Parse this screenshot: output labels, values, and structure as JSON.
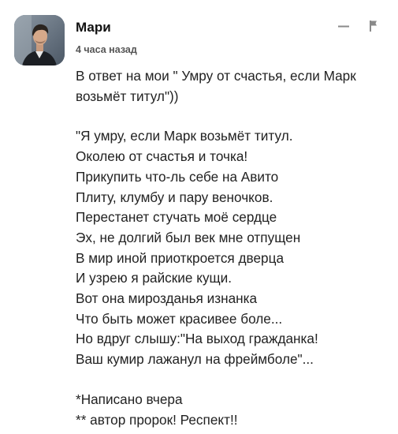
{
  "comment": {
    "author": "Мари",
    "timestamp": "4 часа назад",
    "actions": {
      "minimize_icon": "minus-icon",
      "report_icon": "flag-icon"
    },
    "reply_lines": [
      "В ответ на мои \" Умру от счастья, если Марк",
      "возьмёт титул\"))"
    ],
    "poem_lines": [
      "\"Я умру, если Марк возьмёт титул.",
      "Околею от счастья и точка!",
      "Прикупить что-ль себе на Авито",
      "Плиту, клумбу и пару веночков.",
      "Перестанет стучать моё сердце",
      "Эх, не долгий был век мне отпущен",
      "В мир иной приоткроется дверца",
      "И узрею я райские кущи.",
      "Вот она мирозданья изнанка",
      "Что быть может красивее боле...",
      "Но вдруг слышу:\"На выход гражданка!",
      "Ваш кумир лажанул на фреймболе\"..."
    ],
    "note_lines": [
      "*Написано вчера",
      "** автор пророк! Респект!!"
    ],
    "colors": {
      "text": "#222222",
      "muted": "#555555",
      "icon": "#8a8a8a"
    }
  }
}
